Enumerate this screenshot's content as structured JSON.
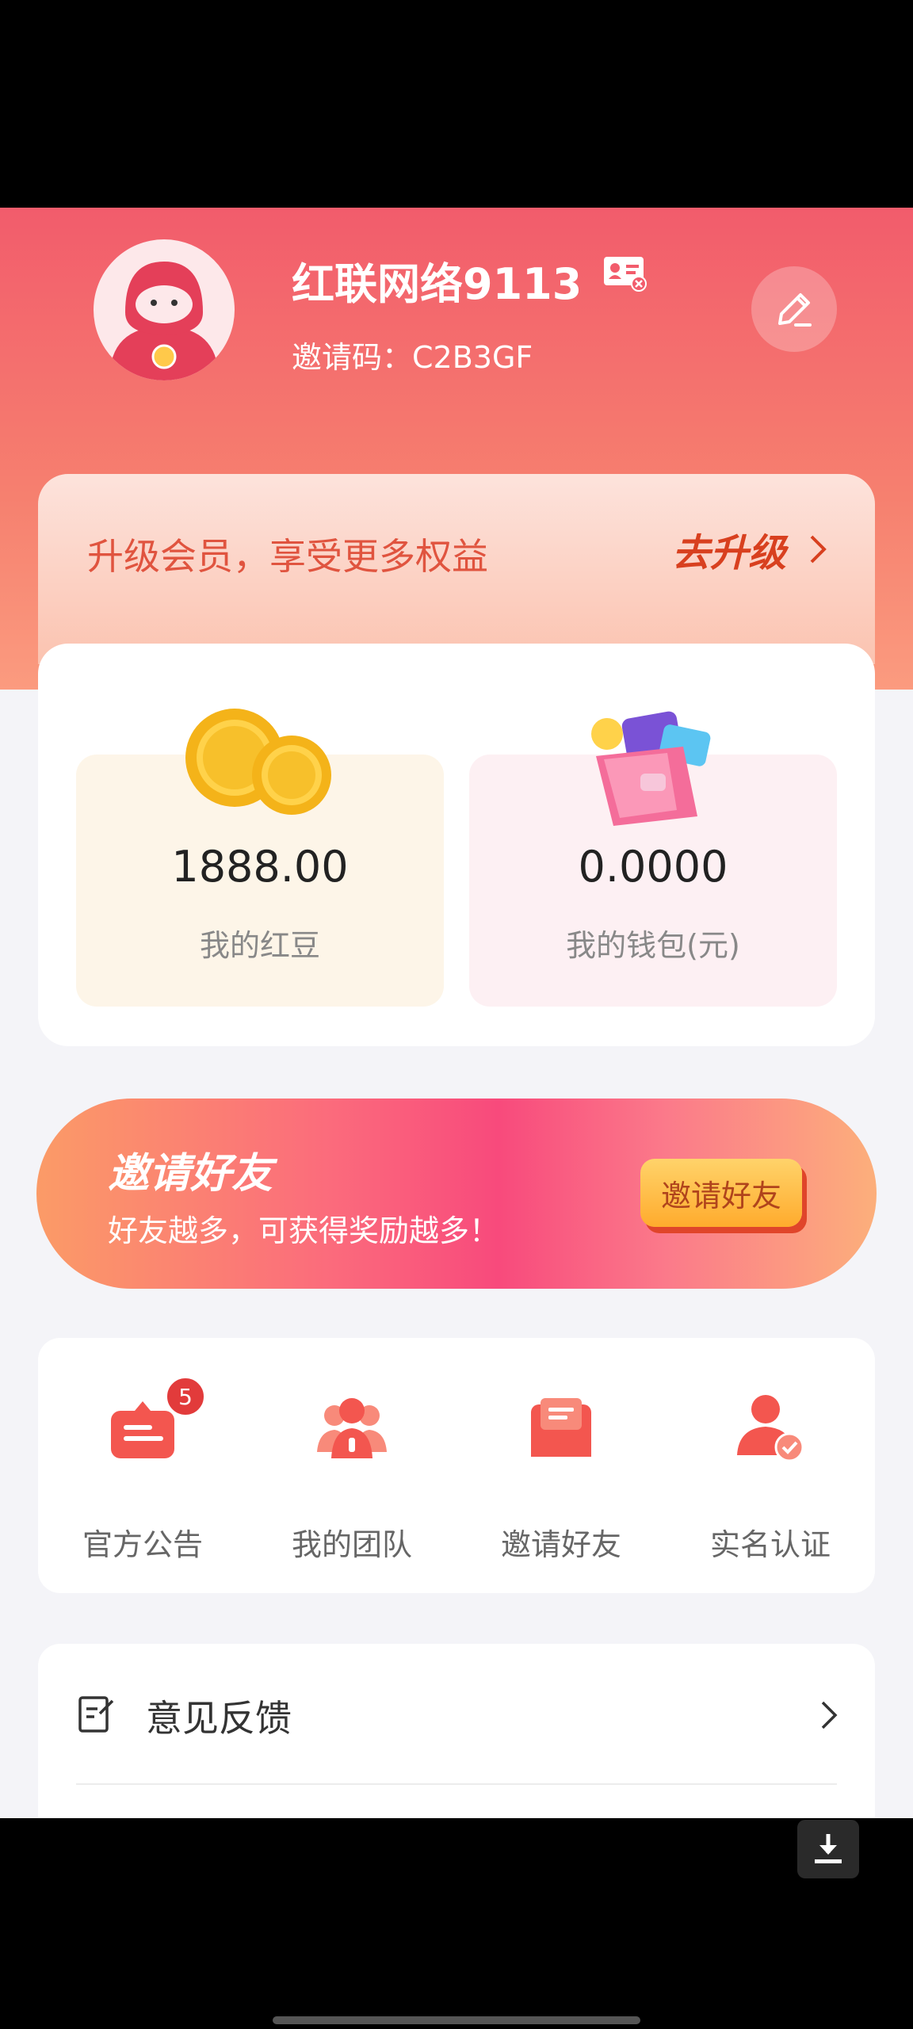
{
  "profile": {
    "username": "红联网络9113",
    "invite_code": "邀请码：C2B3GF"
  },
  "upgrade": {
    "text": "升级会员，享受更多权益",
    "link": "去升级"
  },
  "assets": {
    "beans_value": "1888.00",
    "beans_label": "我的红豆",
    "wallet_value": "0.0000",
    "wallet_label": "我的钱包(元)"
  },
  "invite_banner": {
    "title": "邀请好友",
    "subtitle": "好友越多，可获得奖励越多！",
    "button": "邀请好友"
  },
  "shortcuts": [
    {
      "label": "官方公告",
      "icon": "announcement-icon",
      "badge": "5"
    },
    {
      "label": "我的团队",
      "icon": "team-icon"
    },
    {
      "label": "邀请好友",
      "icon": "invite-mail-icon"
    },
    {
      "label": "实名认证",
      "icon": "verified-user-icon"
    }
  ],
  "menu": {
    "feedback_label": "意见反馈"
  },
  "colors": {
    "brand_red": "#f25c6c",
    "upgrade_text": "#e0543f",
    "badge": "#e23b3b"
  }
}
